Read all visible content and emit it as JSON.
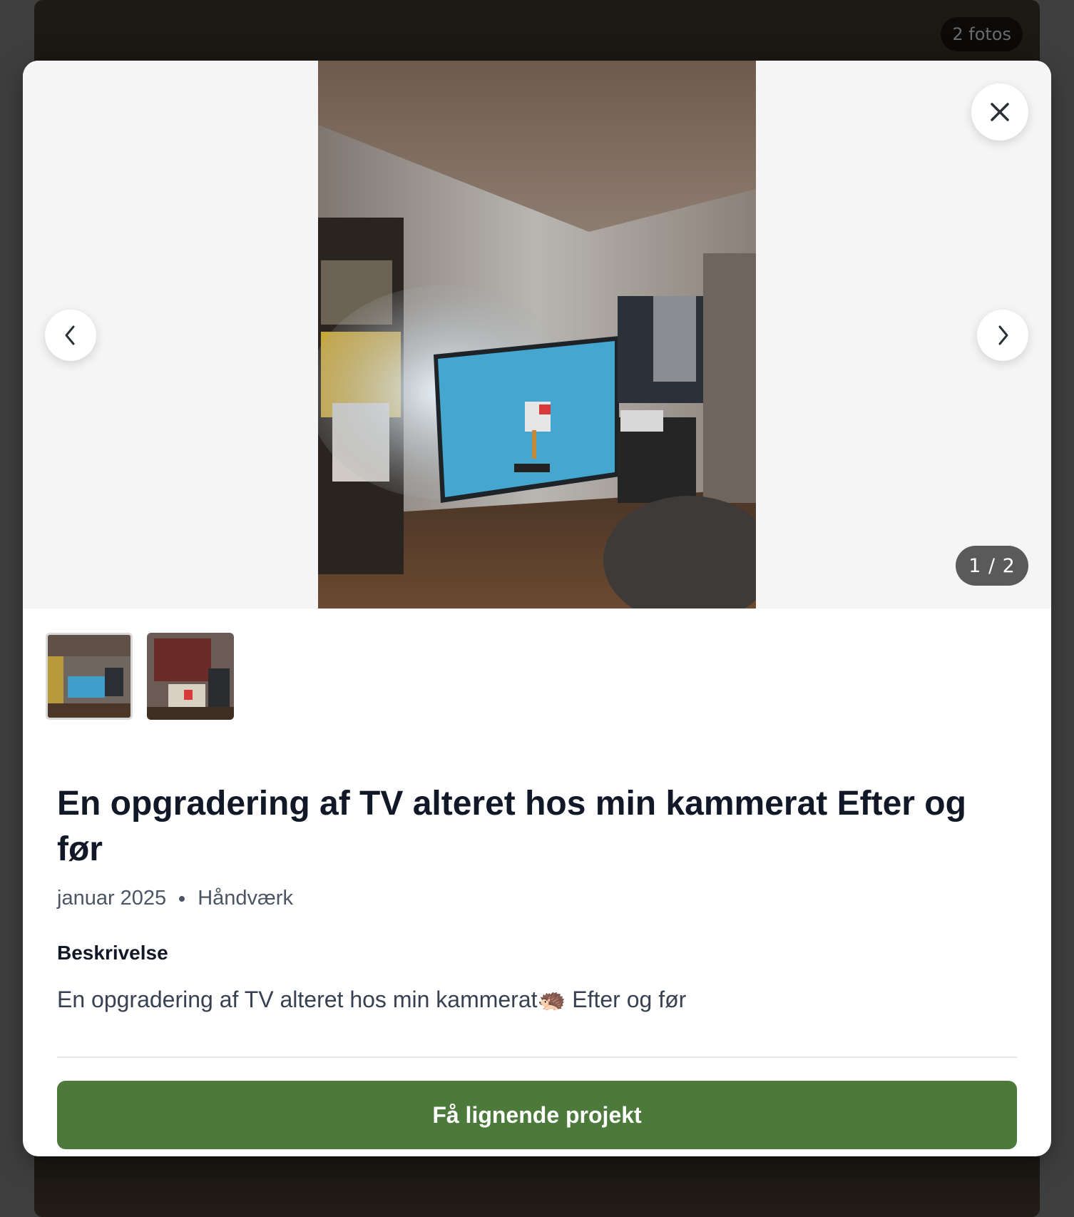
{
  "background": {
    "photo_count": "2 fotos"
  },
  "modal": {
    "close_icon": "close-icon",
    "prev_icon": "chevron-left-icon",
    "next_icon": "chevron-right-icon",
    "counter": "1 / 2",
    "thumbnails": [
      {
        "name": "thumbnail-1",
        "active": true
      },
      {
        "name": "thumbnail-2",
        "active": false
      }
    ],
    "title": "En opgradering af TV alteret hos min kammerat Efter og før",
    "date": "januar 2025",
    "category": "Håndværk",
    "description_heading": "Beskrivelse",
    "description": "En opgradering af TV alteret hos min kammerat🦔 Efter og før",
    "cta_label": "Få lignende projekt"
  },
  "colors": {
    "cta": "#4b7a3a",
    "counter_bg": "#5a5a5a",
    "viewer_bg": "#f5f5f5"
  }
}
